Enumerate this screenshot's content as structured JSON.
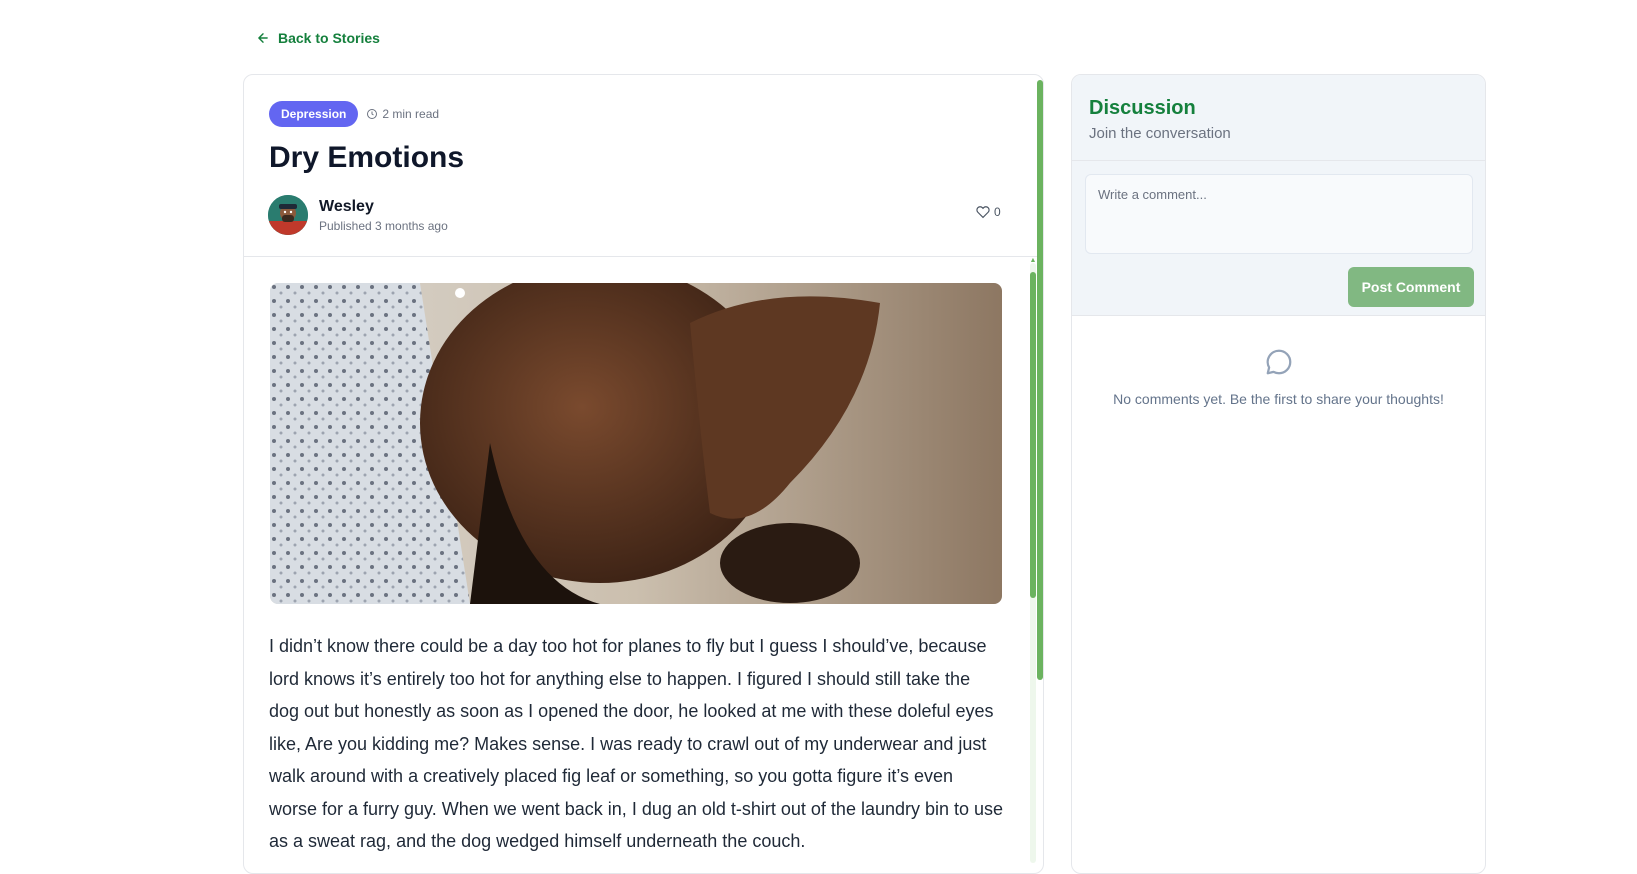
{
  "nav": {
    "back_label": "Back to Stories"
  },
  "story": {
    "category": "Depression",
    "read_time": "2 min read",
    "title": "Dry Emotions",
    "author": "Wesley",
    "published": "Published 3 months ago",
    "likes": "0",
    "body": "I didn’t know there could be a day too hot for planes to fly but I guess I should’ve, because lord knows it’s entirely too hot for anything else to happen. I figured I should still take the dog out but honestly as soon as I opened the door, he looked at me with these doleful eyes like, Are you kidding me? Makes sense. I was ready to crawl out of my underwear and just walk around with a creatively placed fig leaf or something, so you gotta figure it’s even worse for a furry guy. When we went back in, I dug an old t-shirt out of the laundry bin to use as a sweat rag, and the dog wedged himself underneath the couch."
  },
  "discussion": {
    "title": "Discussion",
    "subtitle": "Join the conversation",
    "comment_placeholder": "Write a comment...",
    "post_label": "Post Comment",
    "empty_text": "No comments yet. Be the first to share your thoughts!"
  },
  "colors": {
    "accent_green": "#15803d",
    "tag_purple": "#6366f1",
    "button_green": "#81b882",
    "scrollbar_green": "#6bb35f"
  },
  "icons": {
    "back": "arrow-left-icon",
    "clock": "clock-icon",
    "heart": "heart-icon",
    "comment": "chat-bubble-icon"
  }
}
